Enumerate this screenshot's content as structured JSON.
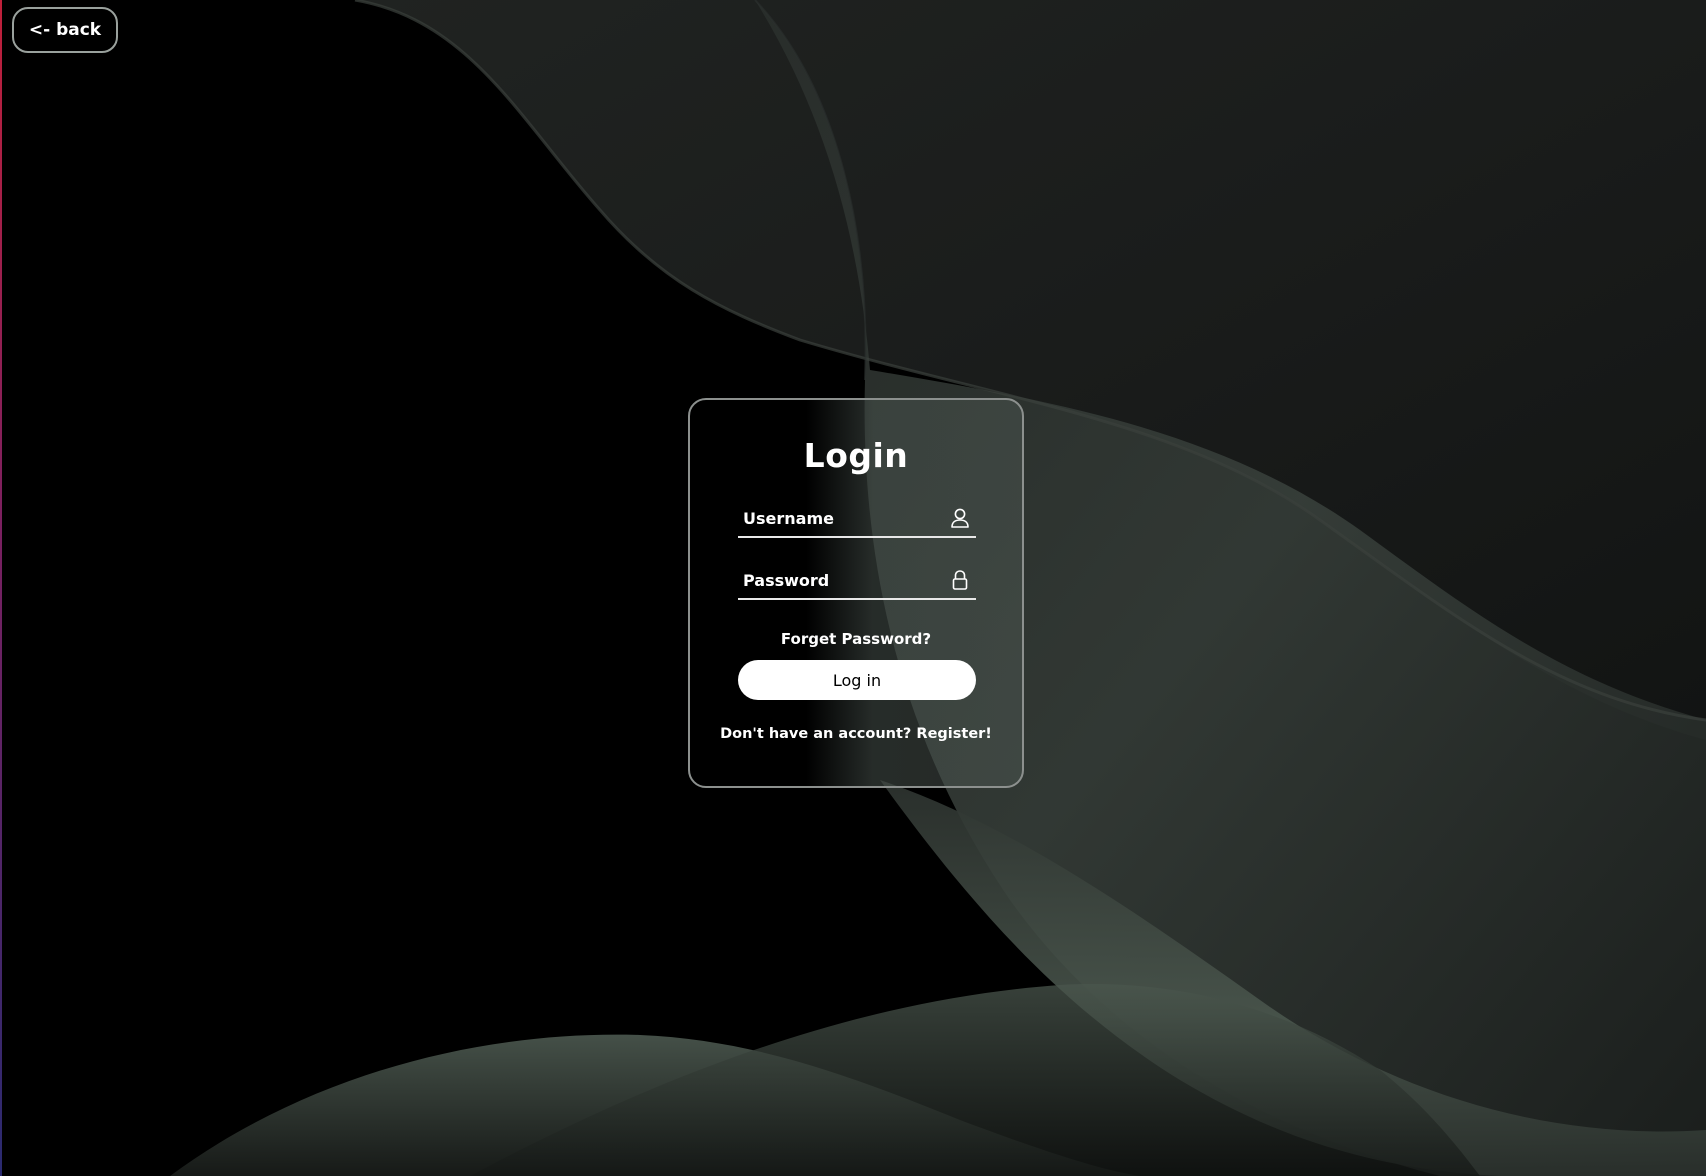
{
  "navigation": {
    "back_label": "<- back"
  },
  "login_form": {
    "title": "Login",
    "username_placeholder": "Username",
    "password_placeholder": "Password",
    "forgot_password_label": "Forget Password?",
    "submit_label": "Log in",
    "register_prompt": "Don't have an account?",
    "register_link_label": "Register!"
  },
  "icons": {
    "username_field": "user-icon",
    "password_field": "lock-icon"
  },
  "colors": {
    "background": "#000000",
    "wave_highlight": "#5d6a60",
    "text": "#ffffff",
    "button_bg": "#ffffff",
    "button_text": "#000000"
  }
}
